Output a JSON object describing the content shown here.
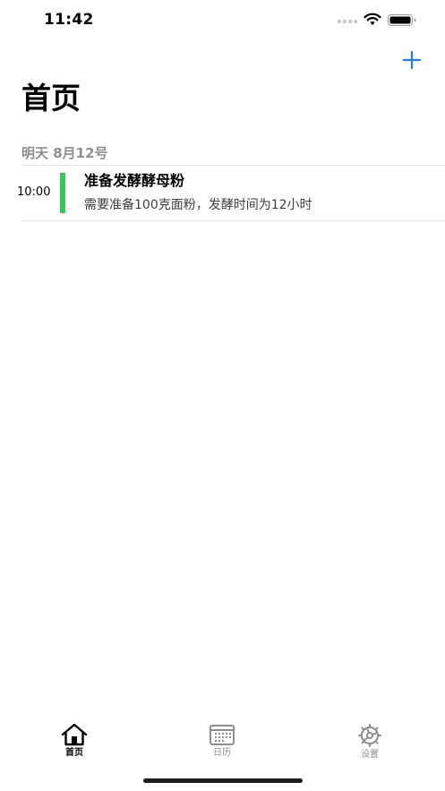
{
  "status_bar": {
    "time": "11:42",
    "icons": [
      "signal-icon",
      "wifi-icon",
      "battery-icon"
    ]
  },
  "header": {
    "add_icon": "plus-icon",
    "title": "首页"
  },
  "section": {
    "header": "明天 8月12号"
  },
  "events": [
    {
      "time": "10:00",
      "title": "准备发酵酵母粉",
      "note": "需要准备100克面粉，发酵时间为12小时",
      "color": "#34C759"
    }
  ],
  "tab_bar": {
    "tabs": [
      {
        "label": "首页",
        "icon": "home-icon",
        "active": true
      },
      {
        "label": "日历",
        "icon": "calendar-icon",
        "active": false
      },
      {
        "label": "设置",
        "icon": "settings-icon",
        "active": false
      }
    ]
  },
  "colors": {
    "accent": "#1E7CF2",
    "event_green": "#34C759",
    "secondary_text": "#8E8E93",
    "divider": "#E5E5EA"
  }
}
